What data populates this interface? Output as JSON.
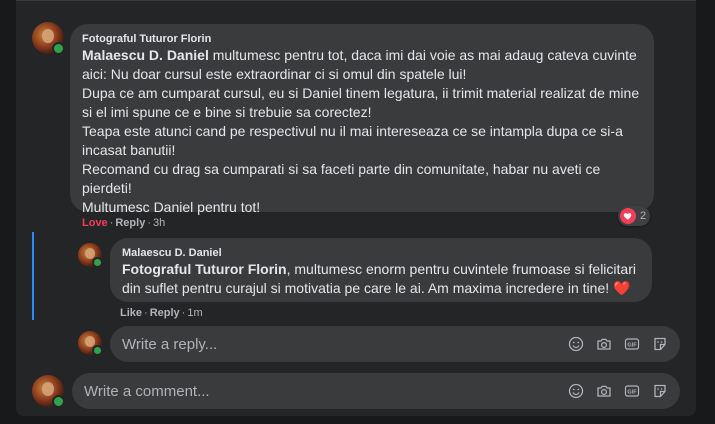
{
  "comment": {
    "author": "Fotograful Tuturor Florin",
    "mention": "Malaescu D. Daniel",
    "text_after_mention": " multumesc pentru tot, daca imi dai voie as mai adaug cateva cuvinte aici: Nu doar cursul este extraordinar ci si omul din spatele lui!\nDupa ce am cumparat cursul, eu si Daniel tinem legatura, ii trimit material realizat de mine si el imi spune ce e bine si trebuie sa corectez!\nTeapa este atunci cand pe respectivul nu il mai intereseaza ce se intampla dupa ce si-a incasat banutii!\nRecomand cu drag sa cumparati si sa faceti parte din comunitate, habar nu aveti ce pierdeti!\nMultumesc Daniel pentru tot!",
    "action_love": "Love",
    "action_reply": "Reply",
    "time": "3h",
    "reaction_icon": "heart-icon",
    "reaction_count": "2"
  },
  "reply": {
    "author": "Malaescu D. Daniel",
    "mention": "Fotograful Tuturor Florin",
    "text_after_mention": ", multumesc enorm pentru cuvintele frumoase si felicitari din suflet pentru curajul si motivatia pe care le ai. Am maxima incredere in tine! ",
    "emoji": "❤️",
    "action_like": "Like",
    "action_reply": "Reply",
    "time": "1m"
  },
  "reply_input": {
    "placeholder": "Write a reply..."
  },
  "comment_input": {
    "placeholder": "Write a comment..."
  },
  "toolbar_icons": [
    "emoji-icon",
    "camera-icon",
    "gif-icon",
    "sticker-icon"
  ],
  "gif_label": "GIF",
  "colors": {
    "accent": "#2d88ff",
    "love": "#f33e58",
    "online": "#31a24c"
  }
}
